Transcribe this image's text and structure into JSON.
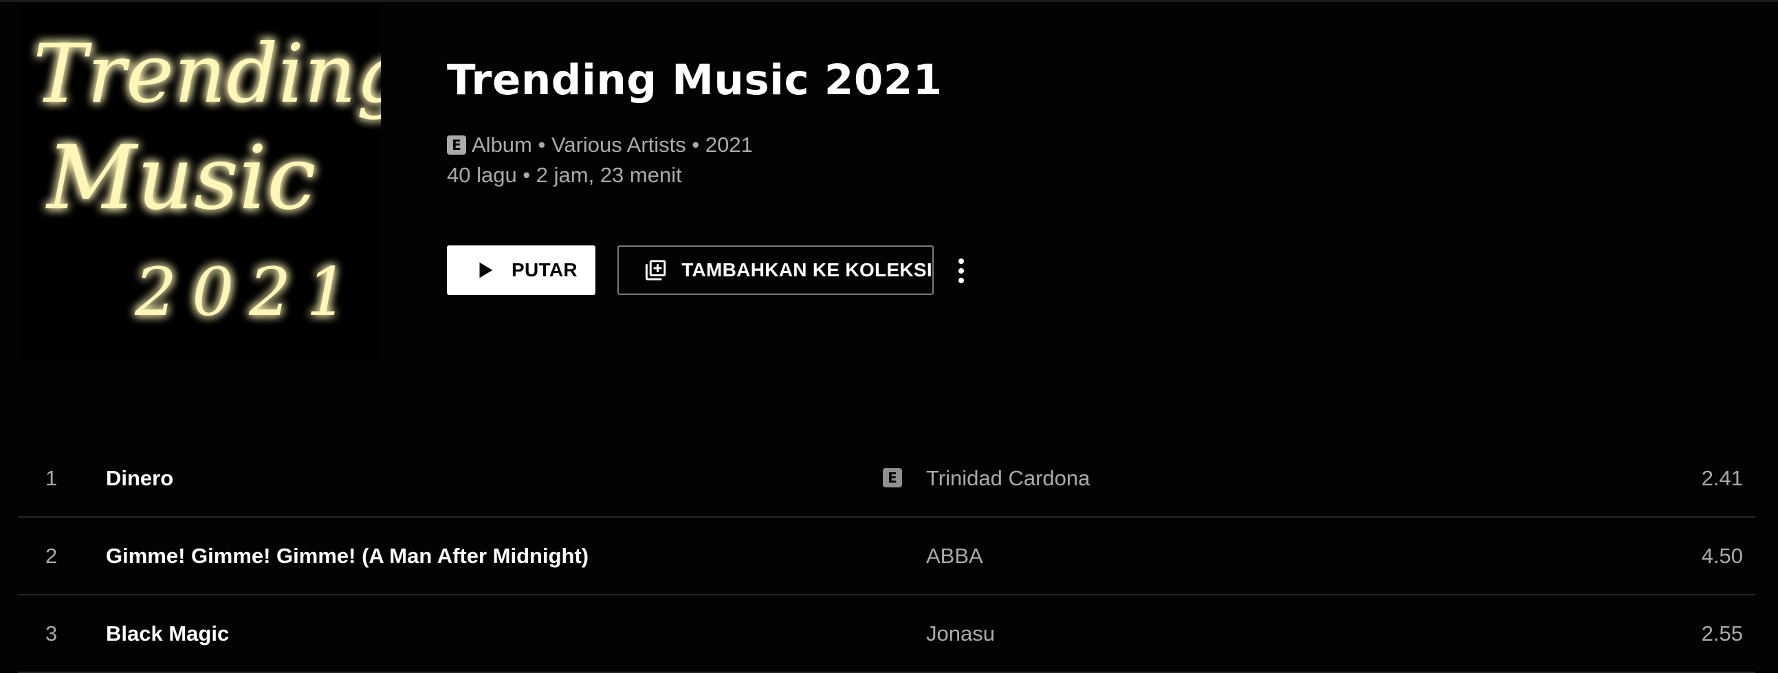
{
  "album": {
    "cover_lines": [
      "Trending",
      "Music",
      "2021"
    ],
    "title": "Trending Music 2021",
    "explicit_badge": "E",
    "meta_line": "Album • Various Artists • 2021",
    "stats_line": "40 lagu • 2 jam, 23 menit"
  },
  "actions": {
    "play_label": "PUTAR",
    "add_label": "TAMBAHKAN KE KOLEKSI",
    "more_icon": "more-vert-icon"
  },
  "tracks": [
    {
      "num": "1",
      "title": "Dinero",
      "explicit": "E",
      "artist": "Trinidad Cardona",
      "duration": "2.41"
    },
    {
      "num": "2",
      "title": "Gimme! Gimme! Gimme! (A Man After Midnight)",
      "artist": "ABBA",
      "duration": "4.50"
    },
    {
      "num": "3",
      "title": "Black Magic",
      "artist": "Jonasu",
      "duration": "2.55"
    }
  ],
  "colors": {
    "background": "#030303",
    "secondary_text": "#aaaaaa",
    "neon": "#fff3a0"
  }
}
